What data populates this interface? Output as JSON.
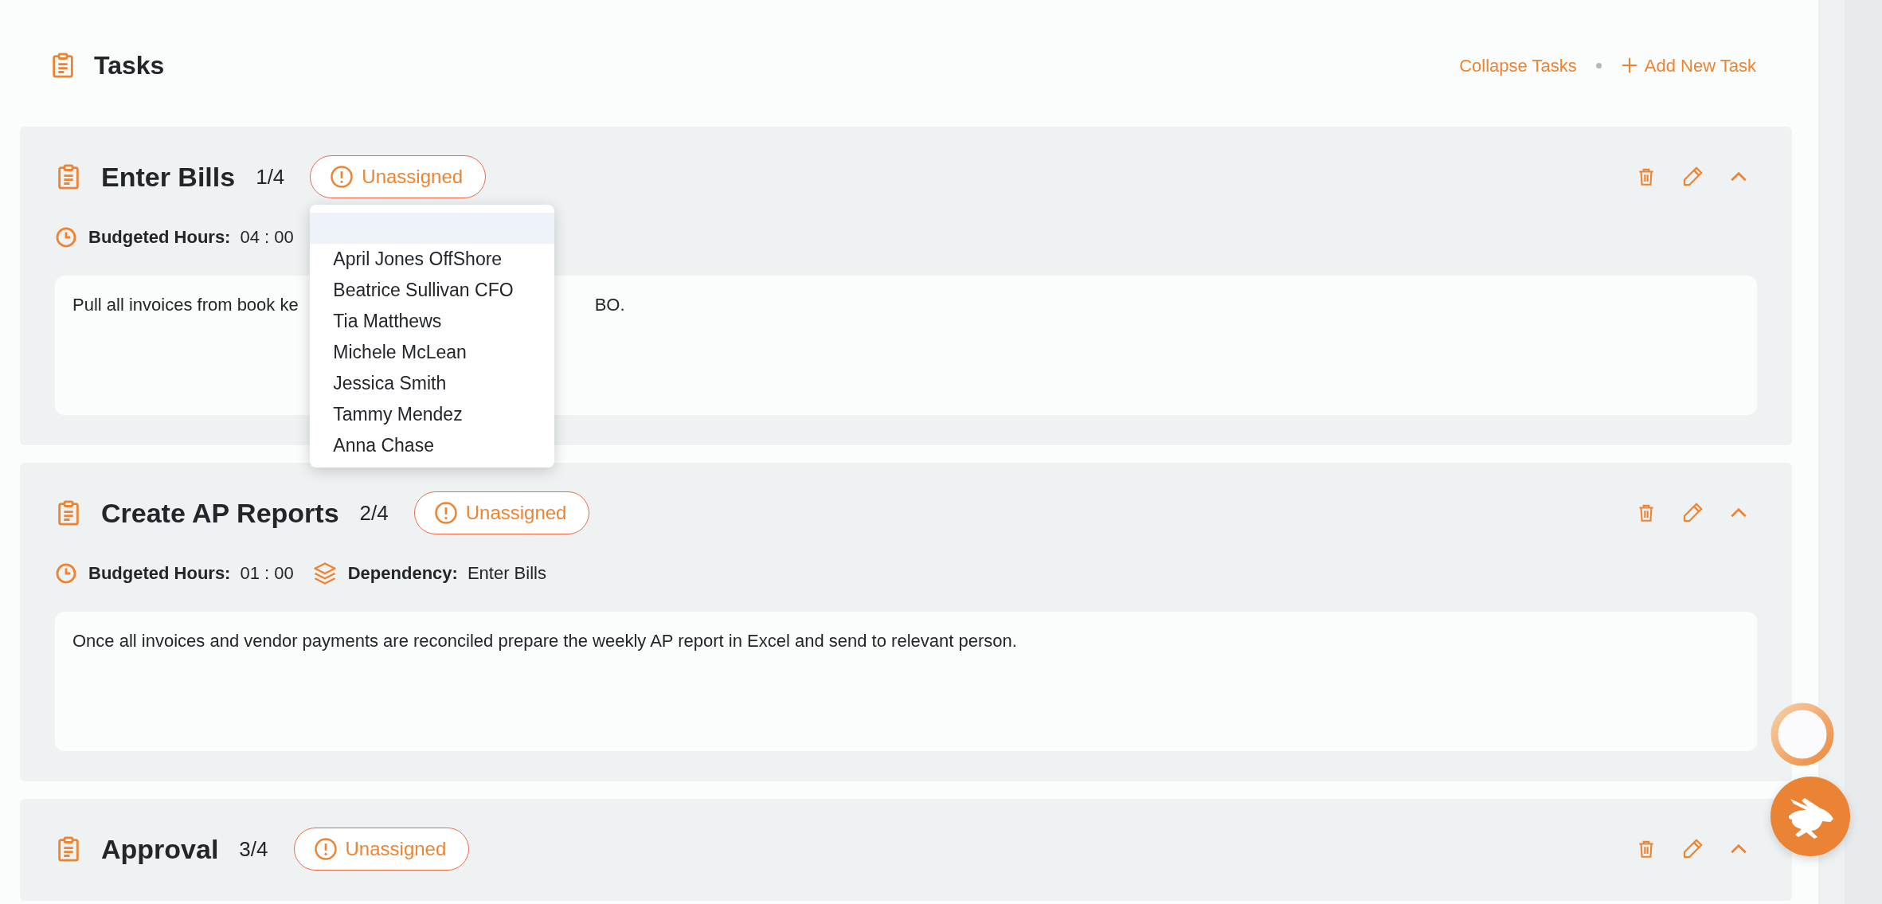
{
  "header": {
    "title": "Tasks",
    "collapse_link": "Collapse Tasks",
    "add_link": "Add New Task"
  },
  "tasks": [
    {
      "title": "Enter Bills",
      "count": "1/4",
      "assignee": "Unassigned",
      "assignee_menu_open": true,
      "expanded": true,
      "budget_label": "Budgeted Hours:",
      "hours": "04 : 00",
      "description_parts": [
        "Pull all invoices from book ke",
        "BO."
      ]
    },
    {
      "title": "Create AP Reports",
      "count": "2/4",
      "assignee": "Unassigned",
      "assignee_menu_open": false,
      "expanded": true,
      "budget_label": "Budgeted Hours:",
      "hours": "01 : 00",
      "dependency_label": "Dependency:",
      "dependency": "Enter Bills",
      "description_parts": [
        "Once all invoices and vendor payments are reconciled prepare the weekly AP report in Excel and send to relevant person."
      ]
    },
    {
      "title": "Approval",
      "count": "3/4",
      "assignee": "Unassigned",
      "assignee_menu_open": false,
      "expanded": true
    }
  ],
  "assignee_menu": {
    "blank_option_highlighted": true,
    "options": [
      "April Jones OffShore",
      "Beatrice Sullivan CFO",
      "Tia Matthews",
      "Michele McLean",
      "Jessica Smith",
      "Tammy Mendez",
      "Anna Chase"
    ]
  }
}
